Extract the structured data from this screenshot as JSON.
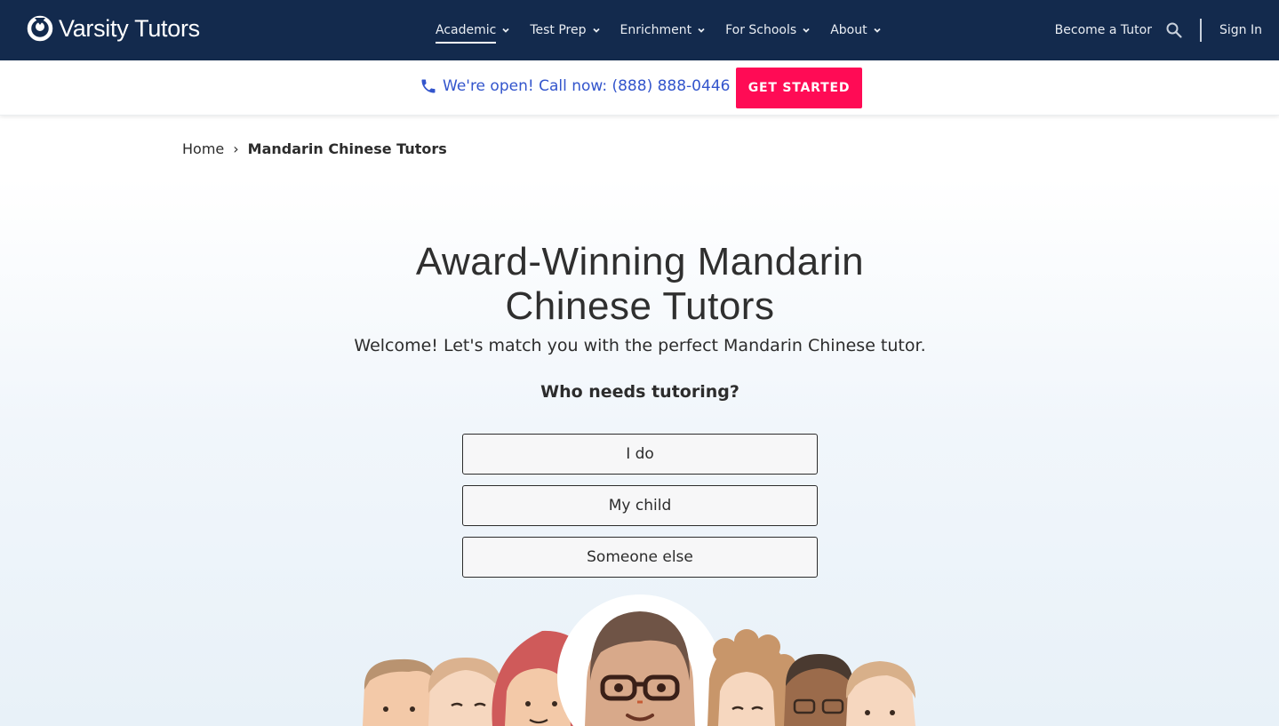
{
  "brand": {
    "name": "Varsity Tutors"
  },
  "nav": {
    "items": [
      {
        "label": "Academic",
        "active": true
      },
      {
        "label": "Test Prep",
        "active": false
      },
      {
        "label": "Enrichment",
        "active": false
      },
      {
        "label": "For Schools",
        "active": false
      },
      {
        "label": "About",
        "active": false
      }
    ],
    "become_tutor": "Become a Tutor",
    "search_icon": "search-icon",
    "sign_in": "Sign In"
  },
  "cta": {
    "phone_text": "We're open! Call now: (888) 888-0446",
    "phone_icon": "phone-icon",
    "button": "GET STARTED"
  },
  "breadcrumb": {
    "home": "Home",
    "separator": "›",
    "current": "Mandarin Chinese Tutors"
  },
  "hero": {
    "title_line1": "Award-Winning Mandarin",
    "title_line2": "Chinese Tutors",
    "subtitle": "Welcome! Let's match you with the perfect Mandarin Chinese tutor.",
    "question": "Who needs tutoring?",
    "options": [
      "I do",
      "My child",
      "Someone else"
    ]
  },
  "colors": {
    "nav_bg": "#132a4d",
    "accent_pink": "#ff0b55",
    "phone_blue": "#3355cc"
  }
}
